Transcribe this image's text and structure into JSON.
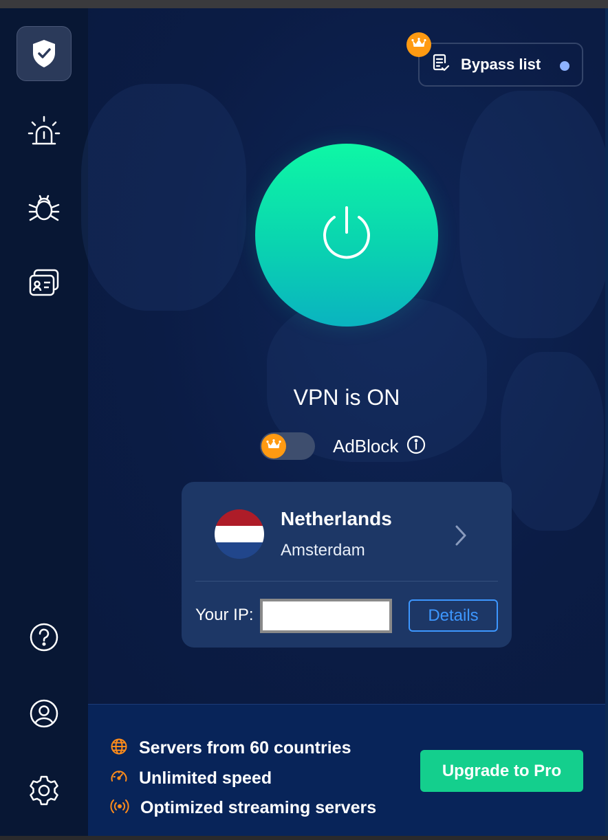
{
  "sidebar": {
    "items": [
      {
        "icon": "shield-check-icon",
        "active": true
      },
      {
        "icon": "alarm-icon",
        "active": false
      },
      {
        "icon": "bug-icon",
        "active": false
      },
      {
        "icon": "id-card-icon",
        "active": false
      }
    ],
    "bottom": [
      {
        "icon": "help-icon"
      },
      {
        "icon": "account-icon"
      },
      {
        "icon": "settings-icon"
      }
    ]
  },
  "header": {
    "bypass_label": "Bypass list",
    "bypass_icon": "list-check-icon",
    "premium_badge": "crown-icon"
  },
  "vpn": {
    "status": "VPN is ON",
    "power_icon": "power-icon"
  },
  "adblock": {
    "label": "AdBlock",
    "enabled": false,
    "premium": true
  },
  "location": {
    "country": "Netherlands",
    "city": "Amsterdam",
    "flag_colors": [
      "#ae1c28",
      "#ffffff",
      "#21468b"
    ],
    "ip_label": "Your IP:",
    "ip_value": "",
    "details_label": "Details"
  },
  "promo": {
    "features": [
      {
        "icon": "globe-icon",
        "text": "Servers from 60 countries"
      },
      {
        "icon": "speedometer-icon",
        "text": "Unlimited speed"
      },
      {
        "icon": "broadcast-icon",
        "text": "Optimized streaming servers"
      }
    ],
    "upgrade_label": "Upgrade to Pro"
  },
  "colors": {
    "accent_green": "#14cf8d",
    "premium_orange": "#ff9a12",
    "link_blue": "#3d97ff",
    "background": "#0b1b40"
  }
}
